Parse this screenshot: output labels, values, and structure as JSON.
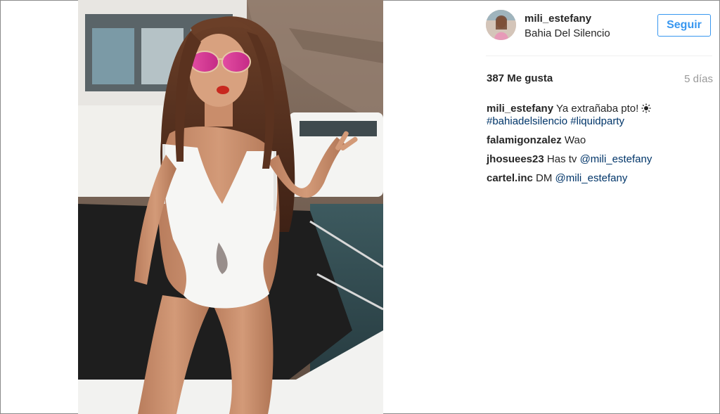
{
  "post": {
    "username": "mili_estefany",
    "location": "Bahia Del Silencio",
    "follow_label": "Seguir",
    "likes": "387 Me gusta",
    "time": "5 días"
  },
  "caption": {
    "user": "mili_estefany",
    "text": "Ya extrañaba pto!",
    "icon": "sun-icon",
    "hashtags": [
      "#bahiadelsilencio",
      "#liquidparty"
    ]
  },
  "comments": [
    {
      "user": "falamigonzalez",
      "text": "Wao",
      "mention": ""
    },
    {
      "user": "jhosuees23",
      "text": "Has tv",
      "mention": "@mili_estefany"
    },
    {
      "user": "cartel.inc",
      "text": "DM",
      "mention": "@mili_estefany"
    }
  ],
  "colors": {
    "accent": "#3897f0",
    "link": "#003569",
    "muted": "#999999"
  }
}
